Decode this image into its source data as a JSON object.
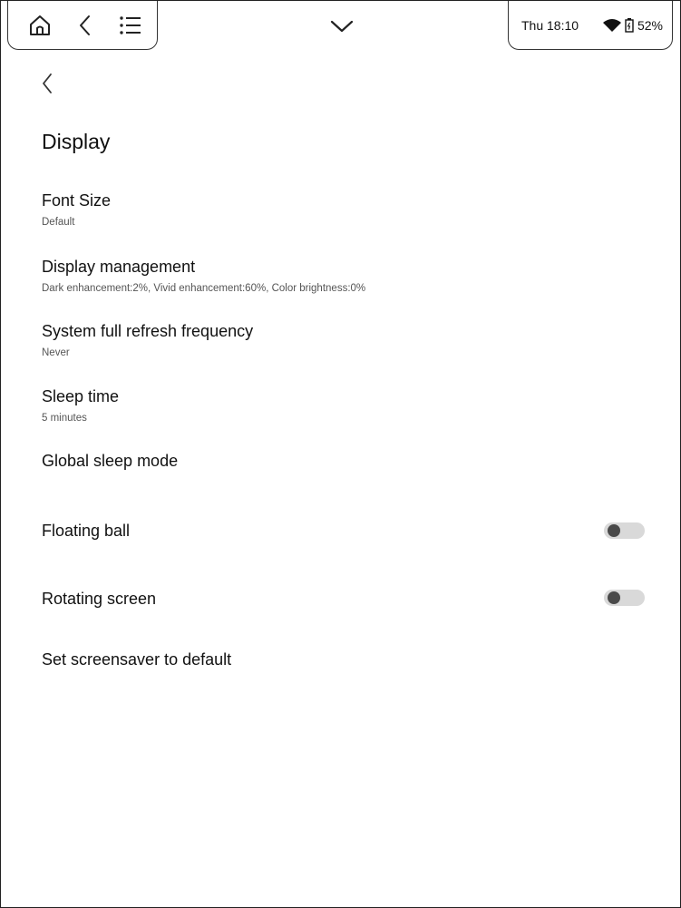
{
  "status_bar": {
    "nav_icons": [
      "home-icon",
      "back-icon",
      "menu-list-icon"
    ],
    "pull_down_icon": "chevron-down-icon",
    "time": "Thu 18:10",
    "battery_percent": "52%"
  },
  "page": {
    "title": "Display"
  },
  "settings": [
    {
      "label": "Font Size",
      "sub": "Default"
    },
    {
      "label": "Display management",
      "sub": "Dark enhancement:2%, Vivid enhancement:60%, Color brightness:0%"
    },
    {
      "label": "System full refresh frequency",
      "sub": "Never"
    },
    {
      "label": "Sleep time",
      "sub": "5 minutes"
    },
    {
      "label": "Global sleep mode"
    },
    {
      "label": "Floating ball",
      "toggle": false
    },
    {
      "label": "Rotating screen",
      "toggle": false
    },
    {
      "label": "Set screensaver to default"
    }
  ]
}
